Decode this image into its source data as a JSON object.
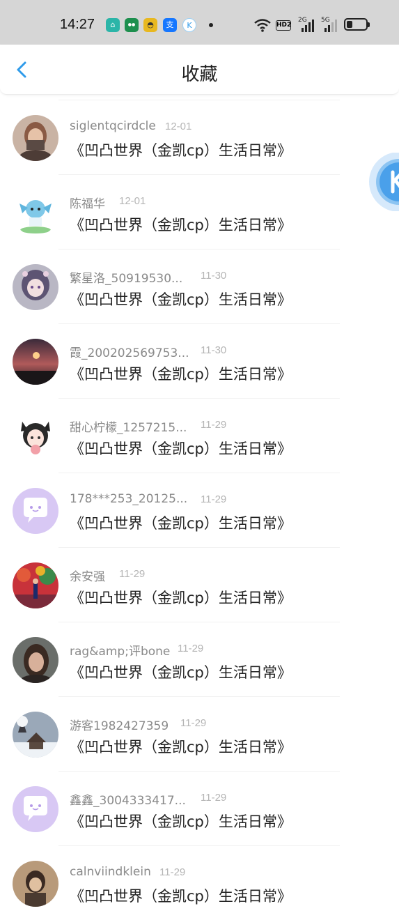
{
  "status_bar": {
    "time": "14:27",
    "network_2g": "2G",
    "network_5g": "5G",
    "hd": "HD2",
    "battery_level": 0.3
  },
  "header": {
    "title": "收藏",
    "back_icon": "chevron-left-icon"
  },
  "colors": {
    "accent": "#2f9bea",
    "status_bar_bg": "#d6d6d6",
    "name_text": "#8a8a8a",
    "date_text": "#b5b5b5"
  },
  "items": [
    {
      "name": "siglentqcirdcle",
      "date": "12-01",
      "title": "《凹凸世界（金凯cp）生活日常》"
    },
    {
      "name": "陈福华",
      "date": "12-01",
      "title": "《凹凸世界（金凯cp）生活日常》"
    },
    {
      "name": "繁星洛_50919530...",
      "date": "11-30",
      "title": "《凹凸世界（金凯cp）生活日常》"
    },
    {
      "name": "霞_200202569753...",
      "date": "11-30",
      "title": "《凹凸世界（金凯cp）生活日常》"
    },
    {
      "name": "甜心柠檬_1257215...",
      "date": "11-29",
      "title": "《凹凸世界（金凯cp）生活日常》"
    },
    {
      "name": "178***253_20125...",
      "date": "11-29",
      "title": "《凹凸世界（金凯cp）生活日常》"
    },
    {
      "name": "余安强",
      "date": "11-29",
      "title": "《凹凸世界（金凯cp）生活日常》"
    },
    {
      "name": "rag&amp;评bone",
      "date": "11-29",
      "title": "《凹凸世界（金凯cp）生活日常》"
    },
    {
      "name": "游客1982427359",
      "date": "11-29",
      "title": "《凹凸世界（金凯cp）生活日常》"
    },
    {
      "name": "鑫鑫_3004333417...",
      "date": "11-29",
      "title": "《凹凸世界（金凯cp）生活日常》"
    },
    {
      "name": "calnviindklein",
      "date": "11-29",
      "title": "《凹凸世界（金凯cp）生活日常》"
    }
  ]
}
